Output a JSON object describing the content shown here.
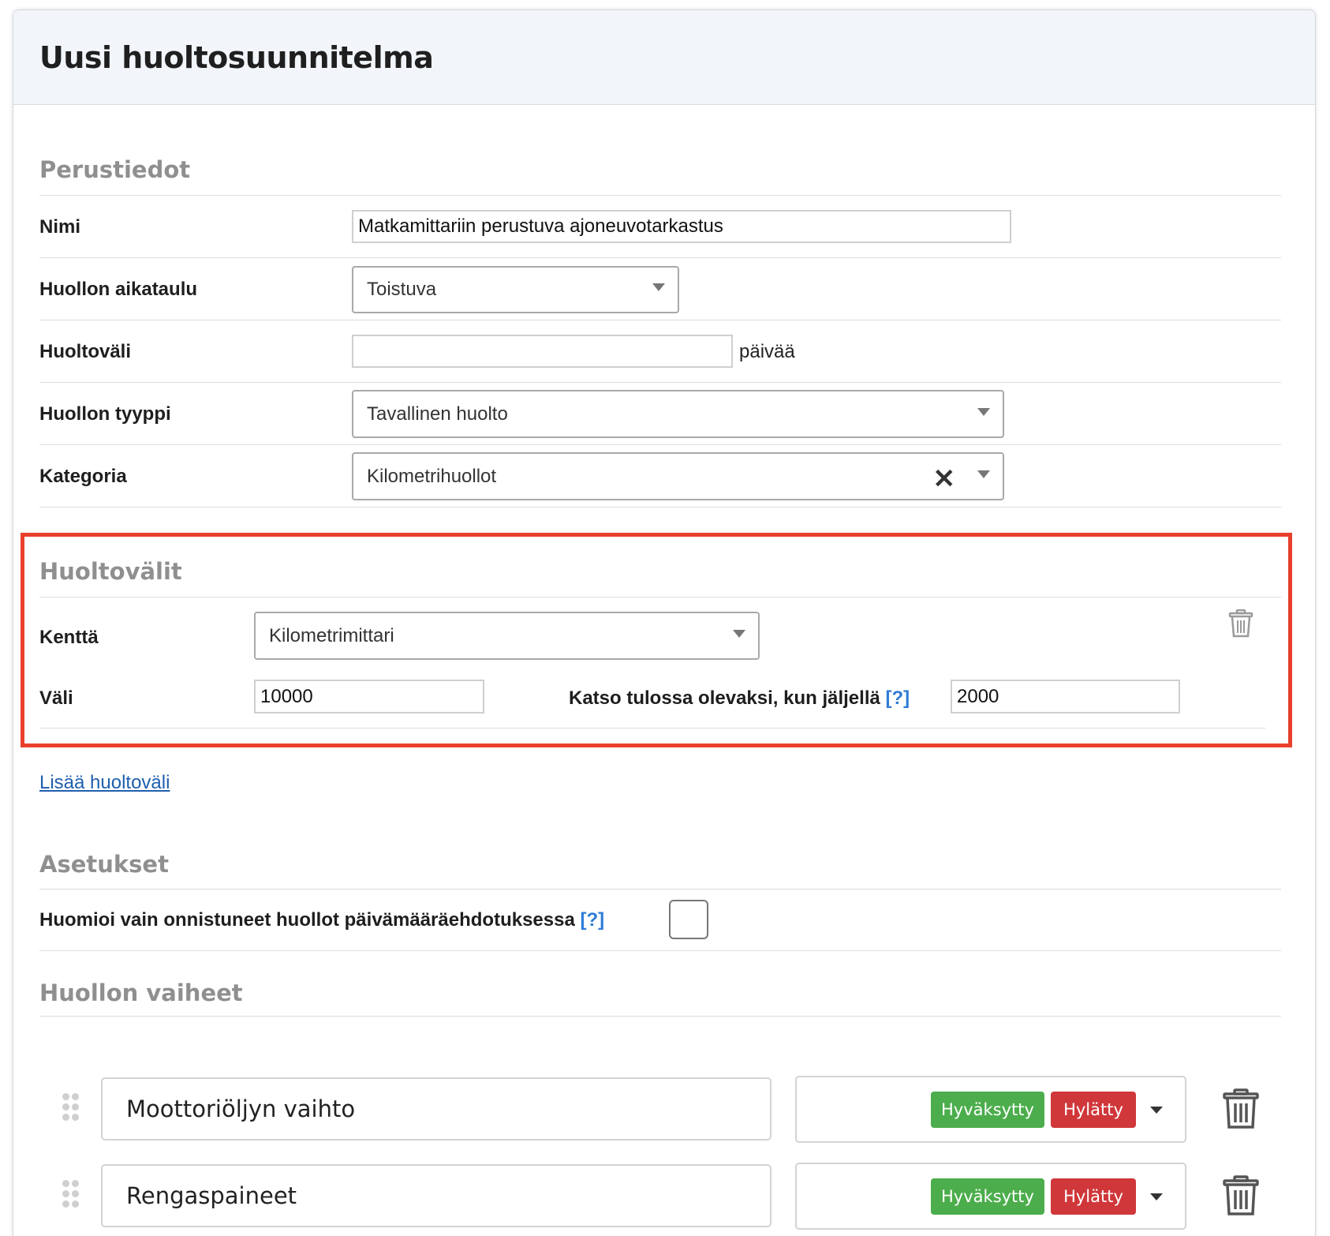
{
  "header": {
    "title": "Uusi huoltosuunnitelma"
  },
  "basic": {
    "section_title": "Perustiedot",
    "name_label": "Nimi",
    "name_value": "Matkamittariin perustuva ajoneuvotarkastus",
    "schedule_label": "Huollon aikataulu",
    "schedule_value": "Toistuva",
    "interval_label": "Huoltoväli",
    "interval_value": "",
    "interval_unit": "päivää",
    "type_label": "Huollon tyyppi",
    "type_value": "Tavallinen huolto",
    "category_label": "Kategoria",
    "category_value": "Kilometrihuollot"
  },
  "intervals": {
    "section_title": "Huoltovälit",
    "field_label": "Kenttä",
    "field_value": "Kilometrimittari",
    "interval_label": "Väli",
    "interval_value": "10000",
    "upcoming_label": "Katso tulossa olevaksi, kun jäljellä",
    "help": "[?]",
    "upcoming_value": "2000",
    "highlight_color": "#e8402c"
  },
  "add_interval_link": "Lisää huoltoväli",
  "settings": {
    "section_title": "Asetukset",
    "only_successful_label": "Huomioi vain onnistuneet huollot päivämääräehdotuksessa",
    "help": "[?]",
    "only_successful_checked": false
  },
  "steps": {
    "section_title": "Huollon vaiheet",
    "approve_label": "Hyväksytty",
    "reject_label": "Hylätty",
    "items": [
      {
        "name": "Moottoriöljyn vaihto"
      },
      {
        "name": "Rengaspaineet"
      }
    ]
  }
}
